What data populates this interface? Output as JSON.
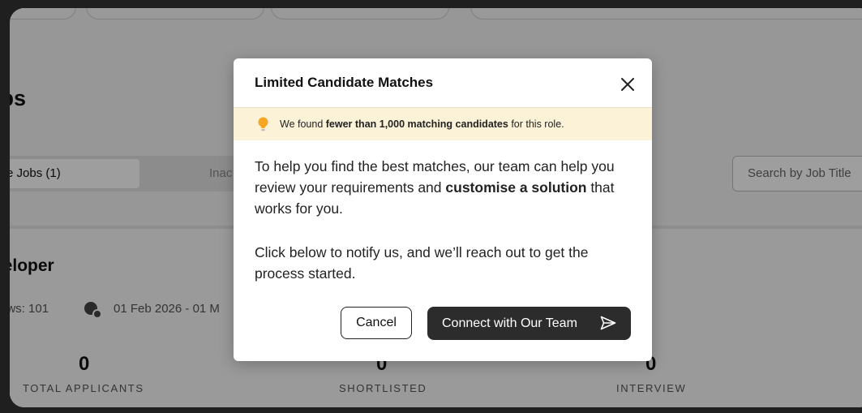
{
  "page": {
    "title": "obs",
    "tabs": [
      {
        "label": "e Jobs (1)",
        "active": true
      },
      {
        "label": "Inac",
        "active": false
      }
    ],
    "search_placeholder": "Search by Job Title"
  },
  "job": {
    "title": "veloper",
    "views": "ews: 101",
    "dates": "01 Feb 2026 - 01 M",
    "stats": [
      {
        "value": "0",
        "label": "TOTAL APPLICANTS"
      },
      {
        "value": "0",
        "label": "SHORTLISTED"
      },
      {
        "value": "0",
        "label": "INTERVIEW"
      }
    ]
  },
  "modal": {
    "title": "Limited Candidate Matches",
    "close_icon": "close-icon",
    "banner": {
      "icon": "lightbulb-icon",
      "icon_color": "#f5a623",
      "pre": "We found ",
      "bold": "fewer than 1,000 matching candidates",
      "post": " for this role."
    },
    "para1": {
      "pre": "To help you find the best matches, our team can help you review your requirements and ",
      "bold": "customise a solution",
      "post": " that works for you."
    },
    "para2": "Click below to notify us, and we’ll reach out to get the process started.",
    "cancel_label": "Cancel",
    "connect_label": "Connect with Our Team",
    "connect_icon": "send-icon"
  },
  "colors": {
    "banner_bg": "#fcf2d8",
    "primary_button": "#2c2c2c",
    "overlay": "rgba(0,0,0,0.38)"
  }
}
